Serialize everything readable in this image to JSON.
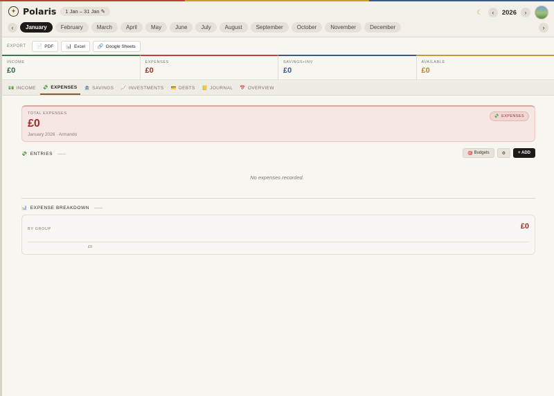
{
  "app": {
    "title": "Polaris",
    "date_range": "1 Jan – 31 Jan ✎",
    "year": "2026",
    "colors": {
      "income": "#2e6b3a",
      "expenses": "#9b2e2a",
      "savings": "#3a5a86",
      "available": "#b8862e"
    }
  },
  "months": [
    "January",
    "February",
    "March",
    "April",
    "May",
    "June",
    "July",
    "August",
    "September",
    "October",
    "November",
    "December"
  ],
  "export": {
    "label": "EXPORT",
    "buttons": [
      "PDF",
      "Excel",
      "Google Sheets"
    ]
  },
  "summary": {
    "income": {
      "label": "INCOME",
      "value": "£0"
    },
    "expenses": {
      "label": "EXPENSES",
      "value": "£0"
    },
    "savings": {
      "label": "SAVINGS+INV",
      "value": "£0"
    },
    "available": {
      "label": "AVAILABLE",
      "value": "£0"
    }
  },
  "tabs": [
    "INCOME",
    "EXPENSES",
    "SAVINGS",
    "INVESTMENTS",
    "DEBTS",
    "JOURNAL",
    "OVERVIEW"
  ],
  "total": {
    "label": "TOTAL EXPENSES",
    "value": "£0",
    "sub": "January 2026 · Armando",
    "badge": "EXPENSES"
  },
  "entries": {
    "title": "ENTRIES",
    "budgets": "Budgets",
    "add": "+ ADD",
    "empty": "No expenses recorded."
  },
  "breakdown": {
    "title": "EXPENSE BREAKDOWN",
    "group_label": "BY GROUP",
    "value": "£0",
    "axis": "£0"
  }
}
